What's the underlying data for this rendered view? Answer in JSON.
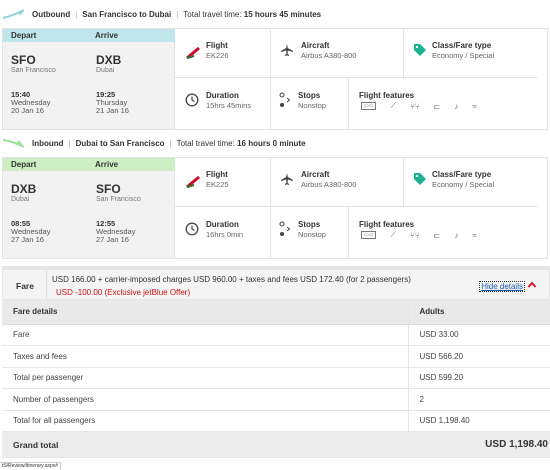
{
  "outbound": {
    "direction": "Outbound",
    "route": "San Francisco to Dubai",
    "travel_time_label": "Total travel time:",
    "travel_time": "15 hours 45 minutes",
    "depart_label": "Depart",
    "arrive_label": "Arrive",
    "depart": {
      "code": "SFO",
      "city": "San Francisco",
      "time": "15:40",
      "day": "Wednesday",
      "date": "20 Jan 16"
    },
    "arrive": {
      "code": "DXB",
      "city": "Dubai",
      "time": "19:25",
      "day": "Thursday",
      "date": "21 Jan 16"
    },
    "flight_label": "Flight",
    "flight": "EK226",
    "aircraft_label": "Aircraft",
    "aircraft": "Airbus A380-800",
    "class_label": "Class/Fare type",
    "class": "Economy / Special",
    "duration_label": "Duration",
    "duration": "15hrs 45mins",
    "stops_label": "Stops",
    "stops": "Nonstop",
    "features_label": "Flight features"
  },
  "inbound": {
    "direction": "Inbound",
    "route": "Dubai to San Francisco",
    "travel_time_label": "Total travel time:",
    "travel_time": "16 hours 0 minute",
    "depart_label": "Depart",
    "arrive_label": "Arrive",
    "depart": {
      "code": "DXB",
      "city": "Dubai",
      "time": "08:55",
      "day": "Wednesday",
      "date": "27 Jan 16"
    },
    "arrive": {
      "code": "SFO",
      "city": "San Francisco",
      "time": "12:55",
      "day": "Wednesday",
      "date": "27 Jan 16"
    },
    "flight_label": "Flight",
    "flight": "EK225",
    "aircraft_label": "Aircraft",
    "aircraft": "Airbus A380-800",
    "class_label": "Class/Fare type",
    "class": "Economy / Special",
    "duration_label": "Duration",
    "duration": "16hrs 0min",
    "stops_label": "Stops",
    "stops": "Nonstop",
    "features_label": "Flight features"
  },
  "feature_icons": [
    "video-icon",
    "seat-recline-icon",
    "meal-icon",
    "power-plug-icon",
    "audio-icon",
    "wifi-icon"
  ],
  "fare": {
    "label": "Fare",
    "summary": "USD 166.00 + carrier-imposed charges USD 960.00 + taxes and fees USD 172.40 (for 2 passengers)",
    "discount": "USD -100.00 (Exclusive jetBlue Offer)",
    "hide_details": "Hide details",
    "table_header": {
      "details": "Fare details",
      "adults": "Adults"
    },
    "rows": [
      {
        "label": "Fare",
        "value": "USD 33.00"
      },
      {
        "label": "Taxes and fees",
        "value": "USD 566.20"
      },
      {
        "label": "Total per passenger",
        "value": "USD 599.20"
      },
      {
        "label": "Number of passengers",
        "value": "2"
      },
      {
        "label": "Total for all passengers",
        "value": "USD 1,198.40"
      }
    ],
    "grand_total_label": "Grand total",
    "grand_total_value": "USD 1,198.40"
  },
  "status_url": "tS/Review/itinerary.aspx#",
  "colors": {
    "outbound_accent": "#bfe6ea",
    "inbound_accent": "#cdeec3",
    "discount_red": "#cc1111",
    "link_blue": "#1a5bb0",
    "chevron_red": "#d01c2a",
    "emirates_red": "#c8102e",
    "class_green": "#19b394"
  }
}
